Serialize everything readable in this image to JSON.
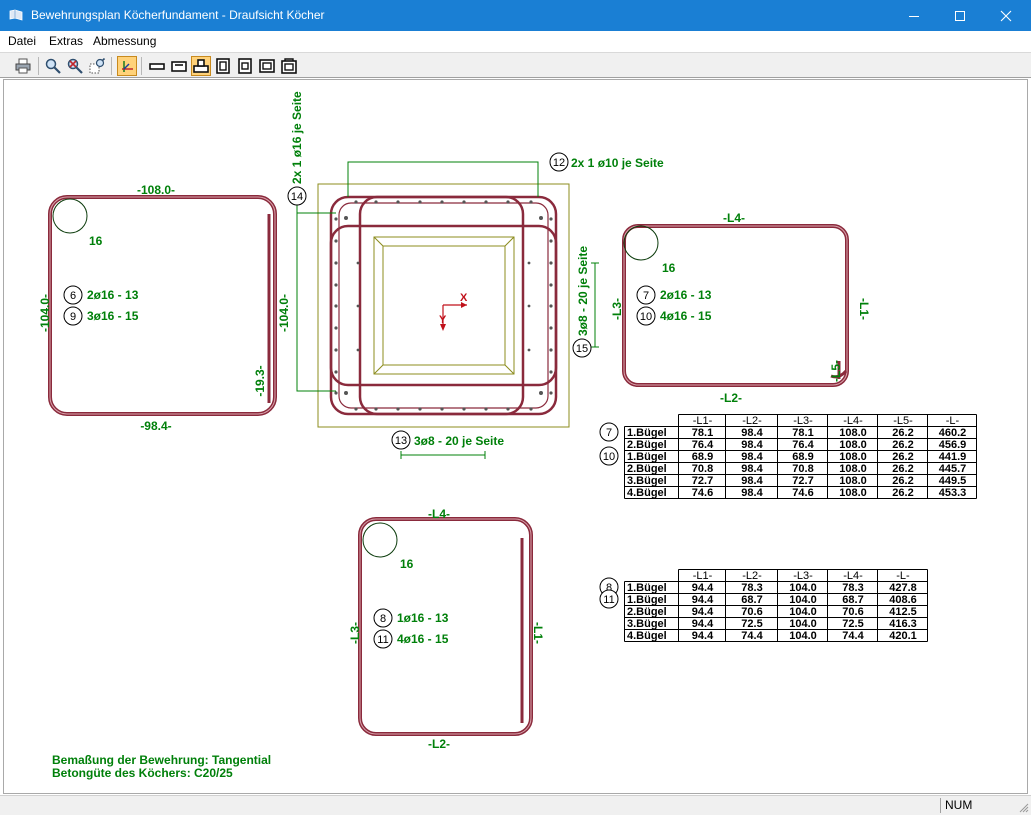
{
  "window": {
    "title": "Bewehrungsplan Köcherfundament - Draufsicht Köcher"
  },
  "menu": {
    "items": [
      "Datei",
      "Extras",
      "Abmessung"
    ]
  },
  "toolbar": {
    "buttons": [
      "print-icon",
      "zoom-in-icon",
      "zoom-reset-icon",
      "zoom-grid-icon",
      "axes-icon",
      "view-front-icon",
      "view-section-icon",
      "view-top-icon",
      "view-side-a-icon",
      "view-side-b-icon",
      "view-side-c-icon",
      "view-side-d-icon"
    ],
    "active": "view-top-icon"
  },
  "drawing": {
    "left_stirrup": {
      "top_dim": "-108.0-",
      "bottom_dim": "-98.4-",
      "left_dim": "-104.0-",
      "right_dim": "-104.0-",
      "hook_dim": "-19.3-",
      "bend_label": "16",
      "pos1_num": "6",
      "pos1_text": "2ø16 - 13",
      "pos2_num": "9",
      "pos2_text": "3ø16 - 15"
    },
    "plan": {
      "pos12_num": "12",
      "pos12_text": "2x 1 ø10 je Seite",
      "pos14_num": "14",
      "pos14_text": "2x 1 ø16 je Seite",
      "pos15_num": "15",
      "pos15_text": "3ø8 - 20 je Seite",
      "pos13_num": "13",
      "pos13_text": "3ø8 - 20 je Seite",
      "axis_x": "X",
      "axis_y": "Y"
    },
    "right_stirrup": {
      "l4": "-L4-",
      "l1": "-L1-",
      "l2": "-L2-",
      "l3": "-L3-",
      "l5": "-L5-",
      "bend_label": "16",
      "pos1_num": "7",
      "pos1_text": "2ø16 - 13",
      "pos2_num": "10",
      "pos2_text": "4ø16 - 15"
    },
    "bottom_stirrup": {
      "l4": "-L4-",
      "l1": "-L1-",
      "l2": "-L2-",
      "l3": "-L3-",
      "bend_label": "16",
      "pos1_num": "8",
      "pos1_text": "1ø16 - 13",
      "pos2_num": "11",
      "pos2_text": "4ø16 - 15"
    },
    "notes": {
      "line1": "Bemaßung  der  Bewehrung: Tangential",
      "line2": "Betongüte des Köchers: C20/25"
    }
  },
  "table1": {
    "markers": [
      "7",
      "10"
    ],
    "headers": [
      "",
      "-L1-",
      "-L2-",
      "-L3-",
      "-L4-",
      "-L5-",
      "-L-"
    ],
    "rows": [
      [
        "1.Bügel",
        "78.1",
        "98.4",
        "78.1",
        "108.0",
        "26.2",
        "460.2"
      ],
      [
        "2.Bügel",
        "76.4",
        "98.4",
        "76.4",
        "108.0",
        "26.2",
        "456.9"
      ],
      [
        "1.Bügel",
        "68.9",
        "98.4",
        "68.9",
        "108.0",
        "26.2",
        "441.9"
      ],
      [
        "2.Bügel",
        "70.8",
        "98.4",
        "70.8",
        "108.0",
        "26.2",
        "445.7"
      ],
      [
        "3.Bügel",
        "72.7",
        "98.4",
        "72.7",
        "108.0",
        "26.2",
        "449.5"
      ],
      [
        "4.Bügel",
        "74.6",
        "98.4",
        "74.6",
        "108.0",
        "26.2",
        "453.3"
      ]
    ]
  },
  "table2": {
    "markers": [
      "8",
      "11"
    ],
    "headers": [
      "",
      "-L1-",
      "-L2-",
      "-L3-",
      "-L4-",
      "-L-"
    ],
    "rows": [
      [
        "1.Bügel",
        "94.4",
        "78.3",
        "104.0",
        "78.3",
        "427.8"
      ],
      [
        "1.Bügel",
        "94.4",
        "68.7",
        "104.0",
        "68.7",
        "408.6"
      ],
      [
        "2.Bügel",
        "94.4",
        "70.6",
        "104.0",
        "70.6",
        "412.5"
      ],
      [
        "3.Bügel",
        "94.4",
        "72.5",
        "104.0",
        "72.5",
        "416.3"
      ],
      [
        "4.Bügel",
        "94.4",
        "74.4",
        "104.0",
        "74.4",
        "420.1"
      ]
    ]
  },
  "status": {
    "num": "NUM"
  },
  "colors": {
    "rebar": "#8a2a3c",
    "label": "#00800a",
    "accent": "#1a7fd4",
    "plan_outline": "#8c8c1e"
  }
}
